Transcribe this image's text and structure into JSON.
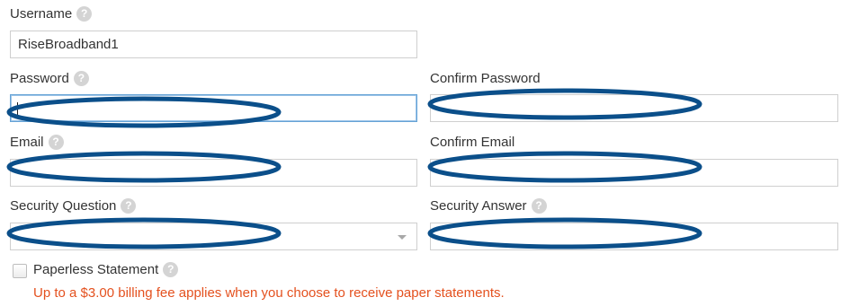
{
  "form": {
    "username": {
      "label": "Username",
      "help_icon": "?",
      "value": "RiseBroadband1"
    },
    "password": {
      "label": "Password",
      "help_icon": "?",
      "value": ""
    },
    "confirm_password": {
      "label": "Confirm Password",
      "value": ""
    },
    "email": {
      "label": "Email",
      "help_icon": "?",
      "value": ""
    },
    "confirm_email": {
      "label": "Confirm Email",
      "value": ""
    },
    "security_question": {
      "label": "Security Question",
      "help_icon": "?",
      "selected": ""
    },
    "security_answer": {
      "label": "Security Answer",
      "help_icon": "?",
      "value": ""
    },
    "paperless": {
      "label": "Paperless Statement",
      "help_icon": "?",
      "checked": false
    },
    "billing_notice": "Up to a $3.00 billing fee applies when you choose to receive paper statements."
  },
  "colors": {
    "redaction_ellipse": "#0b4f8a",
    "notice_text": "#e4511f",
    "focus_border": "#66a3d6"
  }
}
